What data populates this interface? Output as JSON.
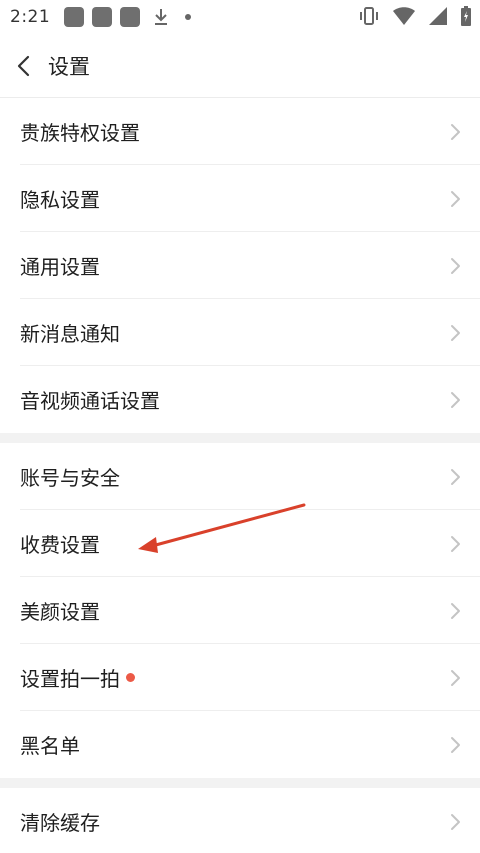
{
  "status_bar": {
    "time": "2:21"
  },
  "header": {
    "title": "设置"
  },
  "groups": [
    {
      "items": [
        {
          "label": "贵族特权设置"
        },
        {
          "label": "隐私设置"
        },
        {
          "label": "通用设置"
        },
        {
          "label": "新消息通知"
        },
        {
          "label": "音视频通话设置"
        }
      ]
    },
    {
      "items": [
        {
          "label": "账号与安全"
        },
        {
          "label": "收费设置"
        },
        {
          "label": "美颜设置"
        },
        {
          "label": "设置拍一拍",
          "badge": "red-dot"
        },
        {
          "label": "黑名单"
        }
      ]
    },
    {
      "items": [
        {
          "label": "清除缓存"
        }
      ]
    }
  ],
  "colors": {
    "annotation_arrow": "#d9412b",
    "badge_dot": "#ec5a47",
    "chevron": "#c4c4c4"
  }
}
